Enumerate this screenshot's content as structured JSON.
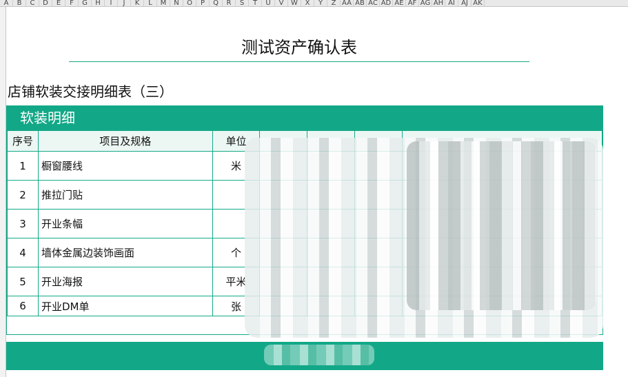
{
  "column_headers": [
    "A",
    "B",
    "C",
    "D",
    "E",
    "F",
    "G",
    "H",
    "I",
    "J",
    "K",
    "L",
    "M",
    "N",
    "O",
    "P",
    "Q",
    "R",
    "S",
    "T",
    "U",
    "V",
    "W",
    "X",
    "Y",
    "Z",
    "AA",
    "AB",
    "AC",
    "AD",
    "AE",
    "AF",
    "AG",
    "AH",
    "AI",
    "AJ",
    "AK"
  ],
  "sheet": {
    "title": "测试资产确认表",
    "subtitle": "店铺软装交接明细表（三）",
    "section_header": "软装明细",
    "table": {
      "headers": {
        "no": "序号",
        "item": "项目及规格",
        "unit": "单位"
      },
      "rows": [
        {
          "no": "1",
          "item": "橱窗腰线",
          "unit": "米"
        },
        {
          "no": "2",
          "item": "推拉门贴",
          "unit": ""
        },
        {
          "no": "3",
          "item": "开业条幅",
          "unit": ""
        },
        {
          "no": "4",
          "item": "墙体金属边装饰画面",
          "unit": "个"
        },
        {
          "no": "5",
          "item": "开业海报",
          "unit": "平米"
        },
        {
          "no": "6",
          "item": "开业DM单",
          "unit": "张"
        }
      ]
    }
  },
  "colors": {
    "accent": "#12a887",
    "header_fill": "#ecf7f4"
  }
}
